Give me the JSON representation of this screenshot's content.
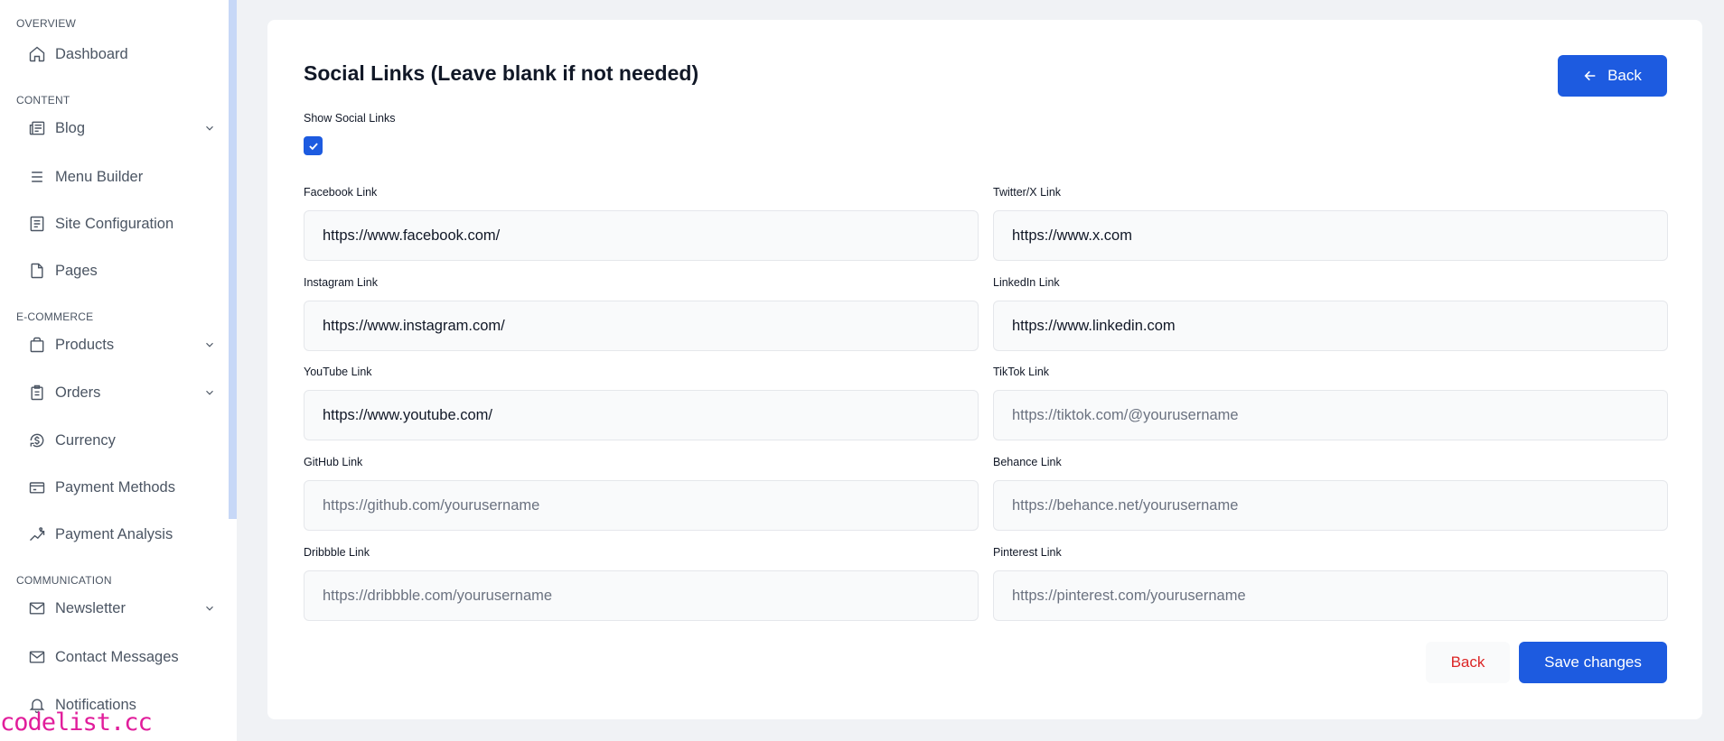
{
  "sidebar": {
    "sections": [
      {
        "title": "OVERVIEW"
      },
      {
        "title": "CONTENT"
      },
      {
        "title": "E-COMMERCE"
      },
      {
        "title": "COMMUNICATION"
      }
    ],
    "items": [
      {
        "label": "Dashboard",
        "icon": "home-icon"
      },
      {
        "label": "Blog",
        "icon": "blog-icon",
        "has_submenu": true
      },
      {
        "label": "Menu Builder",
        "icon": "menu-icon"
      },
      {
        "label": "Site Configuration",
        "icon": "config-icon"
      },
      {
        "label": "Pages",
        "icon": "page-icon"
      },
      {
        "label": "Products",
        "icon": "bag-icon",
        "has_submenu": true
      },
      {
        "label": "Orders",
        "icon": "clipboard-icon",
        "has_submenu": true
      },
      {
        "label": "Currency",
        "icon": "currency-icon"
      },
      {
        "label": "Payment Methods",
        "icon": "card-icon"
      },
      {
        "label": "Payment Analysis",
        "icon": "chart-icon"
      },
      {
        "label": "Newsletter",
        "icon": "mail-icon",
        "has_submenu": true
      },
      {
        "label": "Contact Messages",
        "icon": "mail-icon"
      },
      {
        "label": "Notifications",
        "icon": "bell-icon"
      }
    ],
    "brand": "codelist.cc"
  },
  "form": {
    "title": "Social Links (Leave blank if not needed)",
    "back_label": "Back",
    "show_social_label": "Show Social Links",
    "show_social_checked": true,
    "fields": [
      {
        "label": "Facebook Link",
        "value": "https://www.facebook.com/",
        "placeholder": ""
      },
      {
        "label": "Twitter/X Link",
        "value": "https://www.x.com",
        "placeholder": ""
      },
      {
        "label": "Instagram Link",
        "value": "https://www.instagram.com/",
        "placeholder": ""
      },
      {
        "label": "LinkedIn Link",
        "value": "https://www.linkedin.com",
        "placeholder": ""
      },
      {
        "label": "YouTube Link",
        "value": "https://www.youtube.com/",
        "placeholder": ""
      },
      {
        "label": "TikTok Link",
        "value": "",
        "placeholder": "https://tiktok.com/@yourusername"
      },
      {
        "label": "GitHub Link",
        "value": "",
        "placeholder": "https://github.com/yourusername"
      },
      {
        "label": "Behance Link",
        "value": "",
        "placeholder": "https://behance.net/yourusername"
      },
      {
        "label": "Dribbble Link",
        "value": "",
        "placeholder": "https://dribbble.com/yourusername"
      },
      {
        "label": "Pinterest Link",
        "value": "",
        "placeholder": "https://pinterest.com/yourusername"
      }
    ],
    "cancel_label": "Back",
    "save_label": "Save changes"
  },
  "colors": {
    "primary": "#1d5be0",
    "danger": "#dc2626",
    "brand": "#e11d9b"
  }
}
